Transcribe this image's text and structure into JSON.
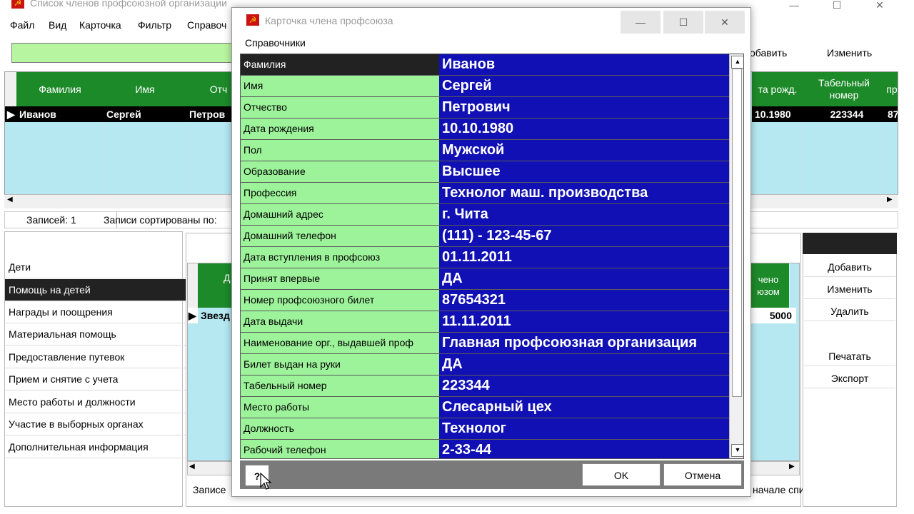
{
  "main_window": {
    "title": "Список членов профсоюзной организации",
    "menu": [
      "Файл",
      "Вид",
      "Карточка",
      "Фильтр",
      "Справоч"
    ],
    "controls": {
      "minimize": "—",
      "maximize": "☐",
      "close": "✕"
    },
    "add_label": "обавить",
    "edit_label": "Изменить",
    "grid": {
      "headers": [
        "Фамилия",
        "Имя",
        "Отч",
        "та рожд.",
        "Табельный номер",
        "пр"
      ],
      "row": [
        "Иванов",
        "Сергей",
        "Петров",
        "10.1980",
        "223344",
        "87"
      ]
    },
    "status": {
      "records": "Записей: 1",
      "sorted": "Записи сортированы по:"
    },
    "left_menu": [
      "Дети",
      "Помощь на детей",
      "Награды и поощрения",
      "Материальная помощь",
      "Предоставление путевок",
      "Прием и снятие с учета",
      "Место работы и должности",
      "Участие в выборных органах",
      "Дополнительная информация"
    ],
    "left_menu_selected": 1,
    "mid_grid": {
      "header_left": "Д",
      "header_right": "чено\nюзом",
      "row_left": "Звезд",
      "row_right": "5000"
    },
    "mid_status": "Записе",
    "mid_status_right": "начале спи",
    "right_buttons": [
      "Добавить",
      "Изменить",
      "Удалить",
      "Печатать",
      "Экспорт"
    ]
  },
  "dialog": {
    "title": "Карточка члена профсоюза",
    "menu": "Справочники",
    "controls": {
      "minimize": "—",
      "maximize": "☐",
      "close": "✕"
    },
    "fields": [
      {
        "label": "Фамилия",
        "value": "Иванов"
      },
      {
        "label": "Имя",
        "value": "Сергей"
      },
      {
        "label": "Отчество",
        "value": "Петрович"
      },
      {
        "label": "Дата рождения",
        "value": "10.10.1980"
      },
      {
        "label": "Пол",
        "value": "Мужской"
      },
      {
        "label": "Образование",
        "value": "Высшее"
      },
      {
        "label": "Профессия",
        "value": "Технолог маш. производства"
      },
      {
        "label": "Домашний адрес",
        "value": "г. Чита"
      },
      {
        "label": "Домашний телефон",
        "value": "(111) - 123-45-67"
      },
      {
        "label": "Дата вступления в профсоюз",
        "value": "01.11.2011"
      },
      {
        "label": "Принят впервые",
        "value": "ДА"
      },
      {
        "label": "Номер профсоюзного билет",
        "value": "87654321"
      },
      {
        "label": "Дата выдачи",
        "value": "11.11.2011"
      },
      {
        "label": "Наименование орг., выдавшей проф",
        "value": "Главная профсоюзная организация"
      },
      {
        "label": "Билет выдан на руки",
        "value": "ДА"
      },
      {
        "label": "Табельный номер",
        "value": "223344"
      },
      {
        "label": "Место работы",
        "value": "Слесарный цех"
      },
      {
        "label": "Должность",
        "value": "Технолог"
      },
      {
        "label": "Рабочий телефон",
        "value": "2-33-44"
      }
    ],
    "help_label": "?",
    "ok_label": "OK",
    "cancel_label": "Отмена"
  },
  "colors": {
    "label_bg": "#9df39a",
    "value_bg": "#1010b4",
    "grid_header": "#1d8a2a",
    "grid_bg": "#b6e8f2",
    "search_bg": "#b8f5a0"
  }
}
